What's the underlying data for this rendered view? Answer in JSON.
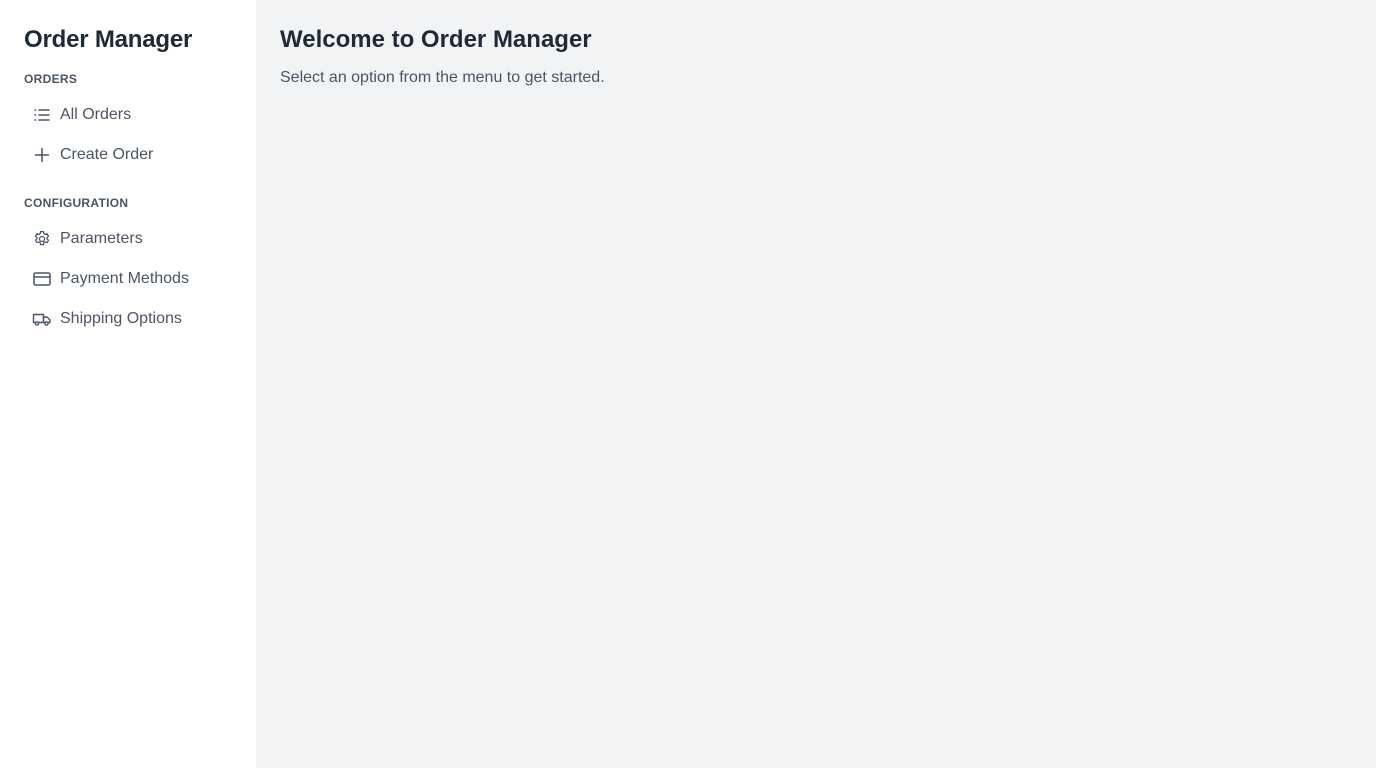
{
  "app": {
    "title": "Order Manager"
  },
  "sidebar": {
    "sections": [
      {
        "heading": "ORDERS",
        "items": [
          {
            "label": "All Orders",
            "icon": "list-icon"
          },
          {
            "label": "Create Order",
            "icon": "plus-icon"
          }
        ]
      },
      {
        "heading": "CONFIGURATION",
        "items": [
          {
            "label": "Parameters",
            "icon": "gear-icon"
          },
          {
            "label": "Payment Methods",
            "icon": "credit-card-icon"
          },
          {
            "label": "Shipping Options",
            "icon": "truck-icon"
          }
        ]
      }
    ]
  },
  "main": {
    "title": "Welcome to Order Manager",
    "subtitle": "Select an option from the menu to get started."
  },
  "colors": {
    "sidebar_bg": "#ffffff",
    "main_bg": "#f2f3f5",
    "text_primary": "#1f2937",
    "text_secondary": "#4b5563"
  }
}
